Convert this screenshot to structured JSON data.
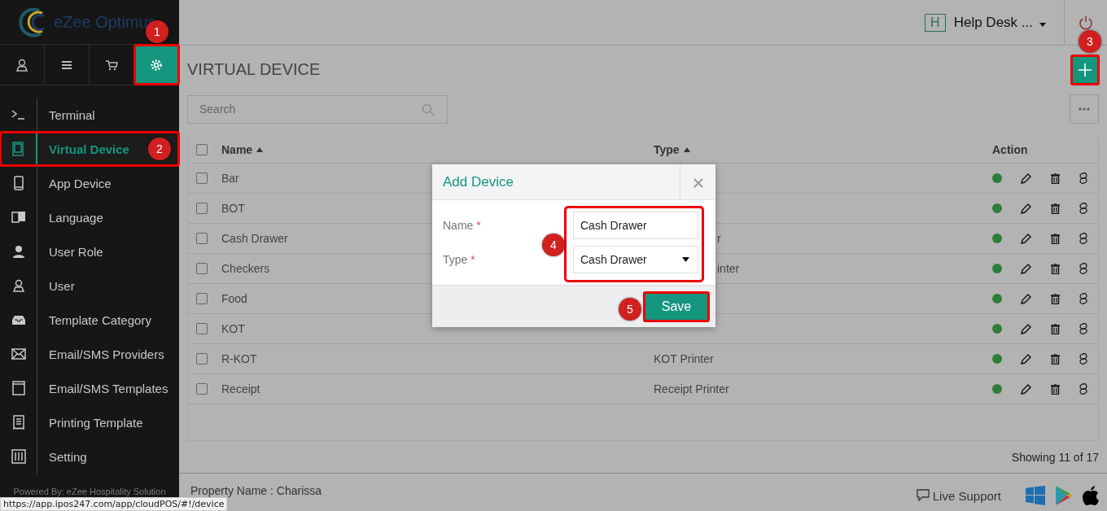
{
  "brand": {
    "name": "eZee Optimus"
  },
  "sidebar": {
    "tabs": [
      {
        "selected": false,
        "highlighted": false
      },
      {
        "selected": false,
        "highlighted": false
      },
      {
        "selected": false,
        "highlighted": false
      },
      {
        "selected": true,
        "highlighted": true
      }
    ],
    "items": [
      {
        "label": "Terminal",
        "selected": false,
        "highlighted": false
      },
      {
        "label": "Virtual Device",
        "selected": true,
        "highlighted": true
      },
      {
        "label": "App Device",
        "selected": false,
        "highlighted": false
      },
      {
        "label": "Language",
        "selected": false,
        "highlighted": false
      },
      {
        "label": "User Role",
        "selected": false,
        "highlighted": false
      },
      {
        "label": "User",
        "selected": false,
        "highlighted": false
      },
      {
        "label": "Template Category",
        "selected": false,
        "highlighted": false
      },
      {
        "label": "Email/SMS Providers",
        "selected": false,
        "highlighted": false
      },
      {
        "label": "Email/SMS Templates",
        "selected": false,
        "highlighted": false
      },
      {
        "label": "Printing Template",
        "selected": false,
        "highlighted": false
      },
      {
        "label": "Setting",
        "selected": false,
        "highlighted": false
      }
    ],
    "footer": "Powered By: eZee Hospitality Solution"
  },
  "header": {
    "avatar_letter": "H",
    "user": "Help Desk ..."
  },
  "page": {
    "title": "VIRTUAL DEVICE",
    "add_highlighted": true,
    "search": {
      "placeholder": "Search"
    }
  },
  "table": {
    "select_all_checked": false,
    "columns": [
      "Name",
      "Type",
      "Action"
    ],
    "rows": [
      {
        "name": "Bar",
        "checked": false,
        "active": true
      },
      {
        "name": "BOT",
        "checked": false,
        "active": true
      },
      {
        "name": "Cash Drawer",
        "type": "r",
        "type_peek": true,
        "checked": false,
        "active": true
      },
      {
        "name": "Checkers",
        "type": "inter",
        "type_peek": true,
        "checked": false,
        "active": true
      },
      {
        "name": "Food",
        "checked": false,
        "active": true
      },
      {
        "name": "KOT",
        "checked": false,
        "active": true
      },
      {
        "name": "R-KOT",
        "type": "KOT Printer",
        "type_peek": false,
        "checked": false,
        "active": true
      },
      {
        "name": "Receipt",
        "type": "Receipt Printer",
        "type_peek": false,
        "checked": false,
        "active": true
      }
    ],
    "count": "Showing 11 of 17"
  },
  "footer": {
    "property": "Property Name : Charissa",
    "support": "Live Support"
  },
  "dialog": {
    "title": "Add Device",
    "fields": [
      {
        "label": "Name",
        "required_mark": "*",
        "kind": "text",
        "value": "Cash Drawer"
      },
      {
        "label": "Type",
        "required_mark": "*",
        "kind": "select",
        "value": "Cash Drawer"
      }
    ],
    "fields_highlighted": true,
    "save": "Save",
    "save_highlighted": true
  },
  "callouts": [
    {
      "label": "1"
    },
    {
      "label": "2"
    },
    {
      "label": "3"
    },
    {
      "label": "4"
    },
    {
      "label": "5"
    }
  ],
  "status_url": "https://app.ipos247.com/app/cloudPOS/#!/device"
}
